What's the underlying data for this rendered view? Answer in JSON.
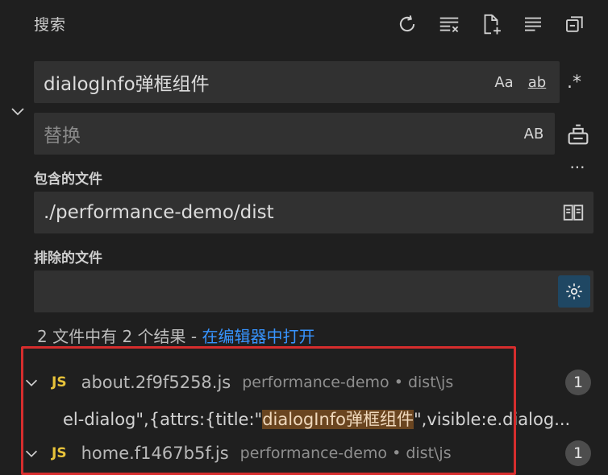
{
  "panel": {
    "title": "搜索",
    "toolbar": [
      {
        "name": "refresh-icon",
        "tooltip": "刷新"
      },
      {
        "name": "clear-results-icon",
        "tooltip": "清除搜索结果"
      },
      {
        "name": "new-search-editor-icon",
        "tooltip": "打开新的搜索编辑器"
      },
      {
        "name": "view-as-list-icon",
        "tooltip": "以列表形式查看"
      },
      {
        "name": "collapse-all-icon",
        "tooltip": "全部折叠"
      }
    ]
  },
  "search": {
    "value": "dialogInfo弹框组件",
    "options": {
      "match_case": "Aa",
      "whole_word": "ab",
      "regex": ".*"
    }
  },
  "replace": {
    "placeholder": "替换",
    "preserve_case": "AB"
  },
  "include": {
    "label": "包含的文件",
    "value": "./performance-demo/dist"
  },
  "exclude": {
    "label": "排除的文件",
    "value": ""
  },
  "more_label": "···",
  "summary": {
    "text": "2 文件中有 2 个结果 - ",
    "link": "在编辑器中打开"
  },
  "results": [
    {
      "badge": "JS",
      "file": "about.2f9f5258.js",
      "path": "performance-demo • dist\\js",
      "count": "1",
      "match": {
        "before": "el-dialog\",{attrs:{title:\"",
        "hit": "dialogInfo弹框组件",
        "after": "\",visible:e.dialog..."
      }
    },
    {
      "badge": "JS",
      "file": "home.f1467b5f.js",
      "path": "performance-demo • dist\\js",
      "count": "1"
    }
  ],
  "colors": {
    "background": "#1f1f1f",
    "input": "#313131",
    "link": "#3794ff",
    "js_badge": "#e8c33a",
    "highlight_box": "#d62d2d",
    "match_highlight": "#6a4520"
  }
}
